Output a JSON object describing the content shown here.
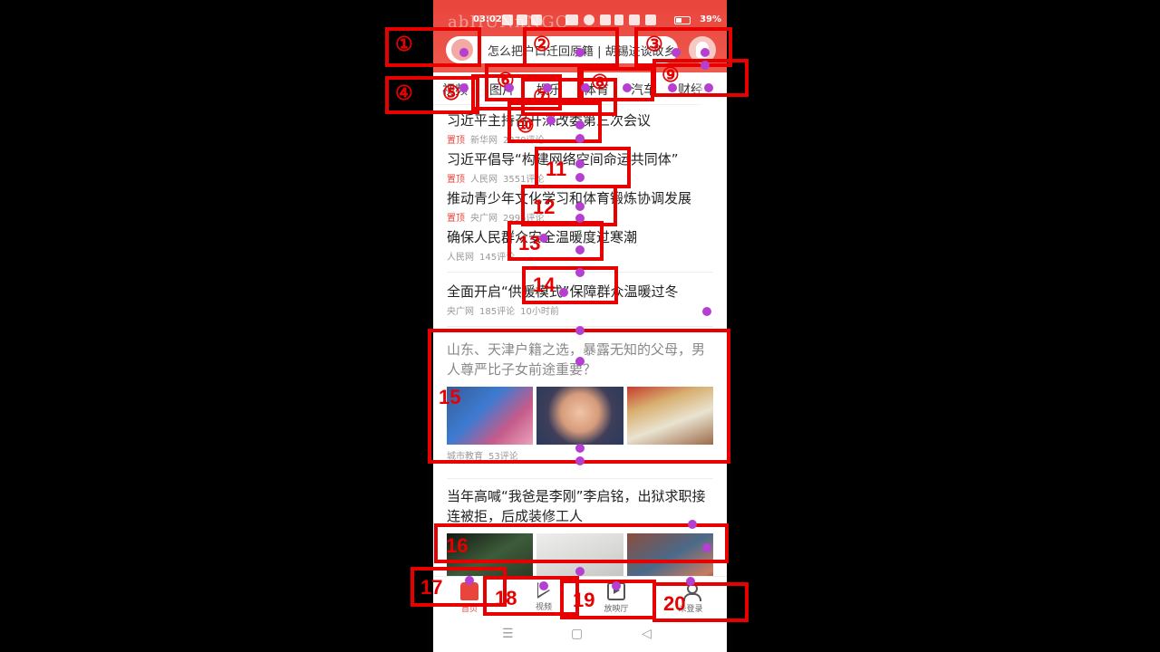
{
  "status": {
    "time": "03:02",
    "battery": "39%"
  },
  "brand_watermark": "abHUNnNGO",
  "search": {
    "text": "怎么把户口迁回原籍 | 胡锡进谈故乡"
  },
  "tabs": [
    {
      "label": "视频",
      "active": false
    },
    {
      "label": "图片",
      "active": false
    },
    {
      "label": "娱乐",
      "active": false
    },
    {
      "label": "体育",
      "active": false
    },
    {
      "label": "汽车",
      "active": false
    },
    {
      "label": "财经",
      "active": false
    }
  ],
  "news": [
    {
      "title": "习近平主持召开深改委第三次会议",
      "pin": "置顶",
      "source": "新华网",
      "comments": "2270评论"
    },
    {
      "title": "习近平倡导“构建网络空间命运共同体”",
      "pin": "置顶",
      "source": "人民网",
      "comments": "3551评论"
    },
    {
      "title": "推动青少年文化学习和体育锻炼协调发展",
      "pin": "置顶",
      "source": "央广网",
      "comments": "2995评论"
    },
    {
      "title": "确保人民群众安全温暖度过寒潮",
      "pin": "",
      "source": "人民网",
      "comments": "145评论"
    },
    {
      "title": "全面开启“供暖模式”保障群众温暖过冬",
      "pin": "",
      "source": "央广网",
      "comments": "185评论",
      "time": "10小时前"
    },
    {
      "title": "山东、天津户籍之选，暴露无知的父母，男人尊严比子女前途重要？",
      "pin": "",
      "source": "城市教育",
      "comments": "53评论"
    },
    {
      "title": "当年高喊“我爸是李刚”李启铭，出狱求职接连被拒，后成装修工人",
      "pin": "",
      "source": "",
      "comments": ""
    }
  ],
  "bottom_nav": [
    {
      "label": "首页",
      "icon": "home-icon"
    },
    {
      "label": "视频",
      "icon": "play-icon"
    },
    {
      "label": "放映厅",
      "icon": "tv-icon"
    },
    {
      "label": "未登录",
      "icon": "user-icon"
    }
  ],
  "system_nav": {
    "menu": "☰",
    "home": "▢",
    "back": "◁"
  },
  "annotations": [
    "①",
    "②",
    "③",
    "④",
    "⑤",
    "⑥",
    "⑦",
    "⑧",
    "⑨",
    "⑩",
    "11",
    "12",
    "13",
    "14",
    "15",
    "16",
    "17",
    "18",
    "19",
    "20"
  ],
  "colors": {
    "accent": "#e8453c",
    "annotation": "#e60000",
    "dot": "#b43fd0"
  }
}
